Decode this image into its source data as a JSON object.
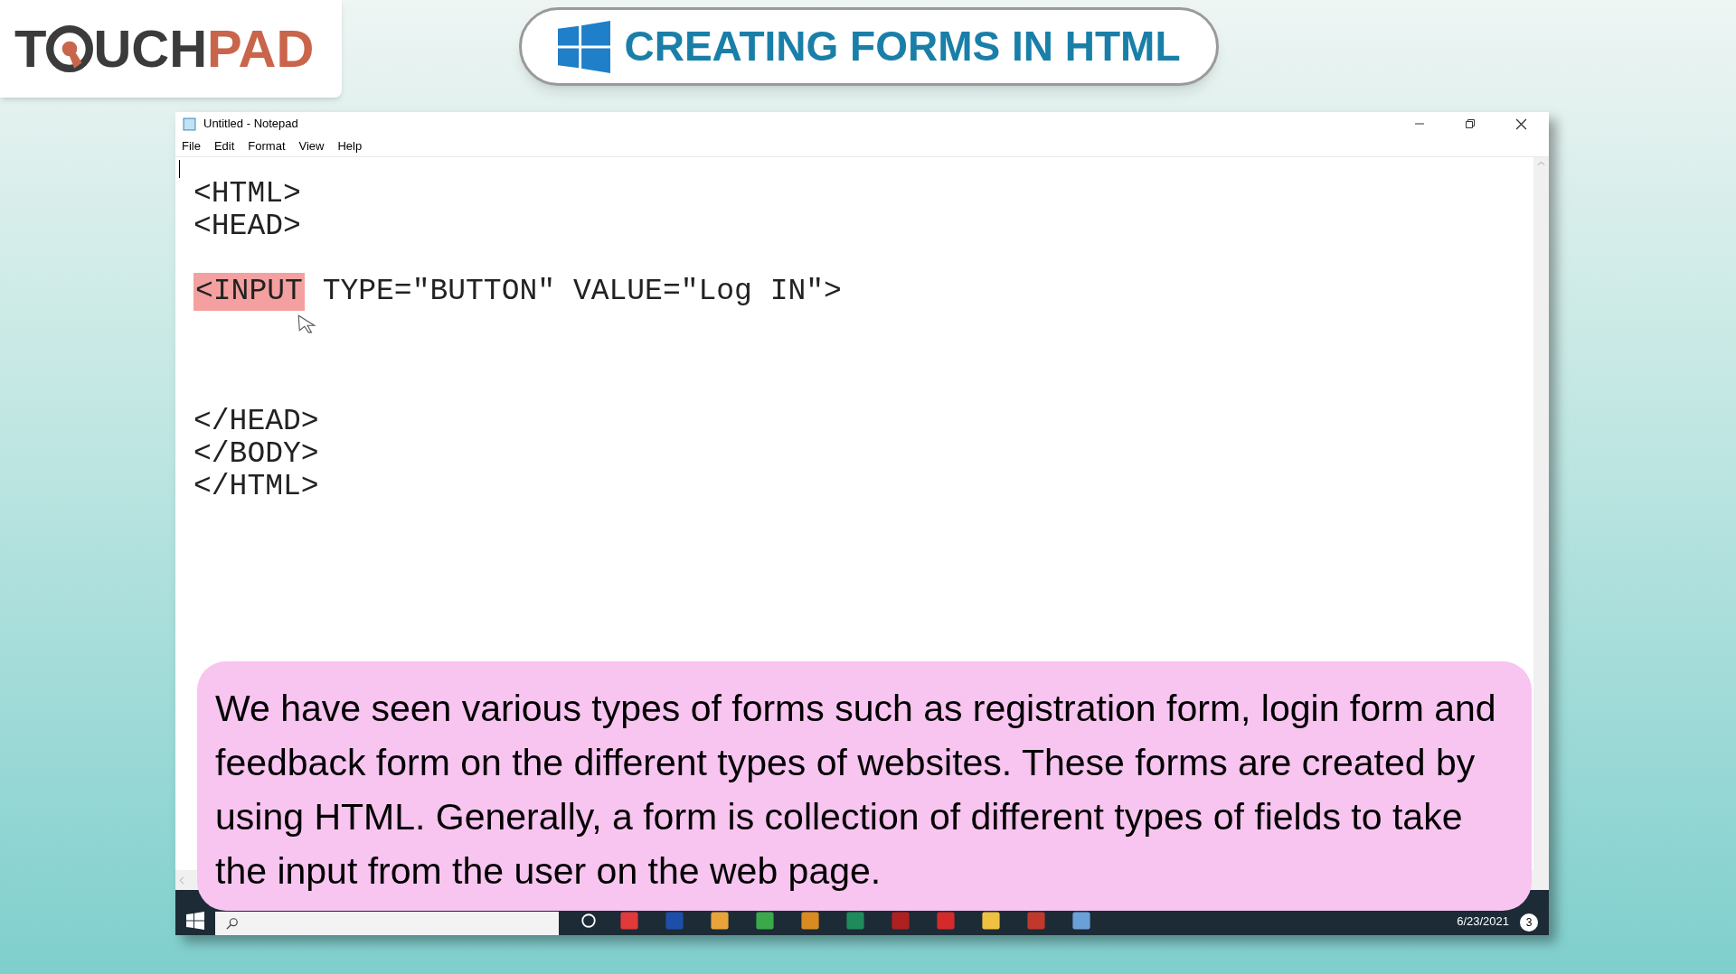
{
  "logo": {
    "prefix": "T",
    "dark": "UCH",
    "accent": "PAD"
  },
  "banner": {
    "title": "CREATING FORMS IN HTML"
  },
  "window": {
    "title": "Untitled - Notepad"
  },
  "menu": [
    "File",
    "Edit",
    "Format",
    "View",
    "Help"
  ],
  "editor": {
    "lines": [
      {
        "kind": "code",
        "segments": [
          {
            "text": "<HTML>",
            "highlighted": false
          }
        ]
      },
      {
        "kind": "code",
        "segments": [
          {
            "text": "<HEAD>",
            "highlighted": false
          }
        ]
      },
      {
        "kind": "blank"
      },
      {
        "kind": "code",
        "segments": [
          {
            "text": "<INPUT",
            "highlighted": true
          },
          {
            "text": " TYPE=\"BUTTON\" VALUE=\"Log IN\">",
            "highlighted": false
          }
        ]
      },
      {
        "kind": "blank"
      },
      {
        "kind": "blank"
      },
      {
        "kind": "blank"
      },
      {
        "kind": "code",
        "segments": [
          {
            "text": "</HEAD>",
            "highlighted": false
          }
        ]
      },
      {
        "kind": "code",
        "segments": [
          {
            "text": "</BODY>",
            "highlighted": false
          }
        ]
      },
      {
        "kind": "code",
        "segments": [
          {
            "text": "</HTML>",
            "highlighted": false
          }
        ]
      }
    ]
  },
  "caption": "We have seen various types of forms such as registration form, login form and feedback form on the different types of websites. These forms are created by using HTML. Generally, a form is collection of different types of fields to take the input from the user on the web page.",
  "taskbar": {
    "date": "6/23/2021",
    "notification_count": "3"
  }
}
